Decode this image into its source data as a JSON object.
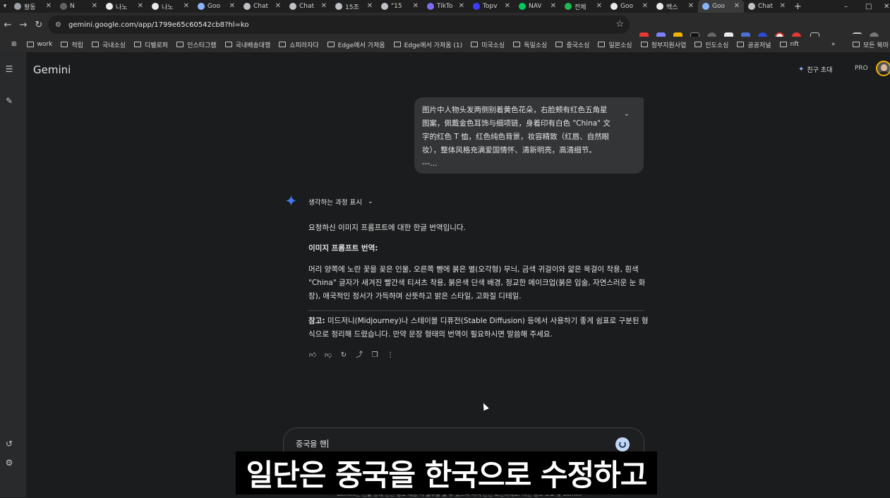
{
  "browser": {
    "tabs": [
      {
        "label": "활동",
        "color": "#9aa0a6"
      },
      {
        "label": "N",
        "color": "#5f6368"
      },
      {
        "label": "나노",
        "color": "#e8eaed"
      },
      {
        "label": "나노",
        "color": "#e8eaed"
      },
      {
        "label": "Goo",
        "color": "#8ab4f8"
      },
      {
        "label": "Chat",
        "color": "#bdc1c6"
      },
      {
        "label": "Chat",
        "color": "#bdc1c6"
      },
      {
        "label": "15조",
        "color": "#bdc1c6"
      },
      {
        "label": "\"15",
        "color": "#bdc1c6"
      },
      {
        "label": "TikTo",
        "color": "#7c6cf0"
      },
      {
        "label": "Topv",
        "color": "#3c3cff"
      },
      {
        "label": "NAV",
        "color": "#03c75a"
      },
      {
        "label": "전체",
        "color": "#1db954"
      },
      {
        "label": "Goo",
        "color": "#e8eaed"
      },
      {
        "label": "백스",
        "color": "#e8eaed"
      },
      {
        "label": "Goo",
        "color": "#8ab4f8"
      },
      {
        "label": "Chat",
        "color": "#bdc1c6"
      }
    ],
    "new_tab": "+",
    "minimize": "–",
    "maximize": "□",
    "close_window": "✕",
    "url": "gemini.google.com/app/1799e65c60542cb8?hl=ko",
    "bookmarks": [
      "work",
      "적립",
      "국내소싱",
      "디벨로퍼",
      "인스타그램",
      "국내배송대행",
      "쇼피라자다",
      "Edge에서 가져옴",
      "Edge에서 가져옴 (1)",
      "미국소싱",
      "독일소싱",
      "중국소싱",
      "일본소싱",
      "정부지원사업",
      "인도소싱",
      "공공저널",
      "nft"
    ],
    "bookmarks_more": "»",
    "all_bookmarks": "모든 북마"
  },
  "app": {
    "brand": "Gemini",
    "invite": "친구 초대",
    "plan": "PRO"
  },
  "user_message": {
    "lines": [
      "图片中人物头发两侧别着黄色花朵，右脸颊有红色五角星",
      "图案，佩戴金色耳饰与细项链，身着印有白色 \"China\" 文",
      "字的红色 T 恤，红色纯色背景，妆容精致（红唇、自然眼",
      "妆），整体风格充满爱国情怀、清新明亮，高清细节。",
      "---..."
    ]
  },
  "response": {
    "thinking_label": "생각하는 과정 표시",
    "intro": "요청하신 이미지 프롬프트에 대한 한글 번역입니다.",
    "section_title": "이미지 프롬프트 번역:",
    "translation": [
      "머리 양쪽에 노란 꽃을 꽂은 인물, 오른쪽 뺨에 붉은 별(오각형) 무늬, 금색 귀걸이와 얇은 목걸이 착용, 흰색",
      "\"China\" 글자가 새겨진 빨간색 티셔츠 착용, 붉은색 단색 배경, 정교한 메이크업(붉은 입술, 자연스러운 눈 화",
      "장), 애국적인 정서가 가득하며 산뜻하고 밝은 스타일, 고화질 디테일."
    ],
    "note_label": "참고:",
    "note": [
      " 미드저니(Midjourney)나 스테이블 디퓨전(Stable Diffusion) 등에서 사용하기 좋게 쉼표로 구분된 형",
      "식으로 정리해 드렸습니다. 만약 문장 형태의 번역이 필요하시면 말씀해 주세요."
    ]
  },
  "composer": {
    "value": "중국을 핸"
  },
  "disclaimer": "Gemini는 인물 등에 관한 정보 제공 시 실수를 할 수 있으니 다시 한번 확인하세요. 개인 정보 보호 및 Gemini",
  "caption": "일단은 중국을 한국으로 수정하고"
}
